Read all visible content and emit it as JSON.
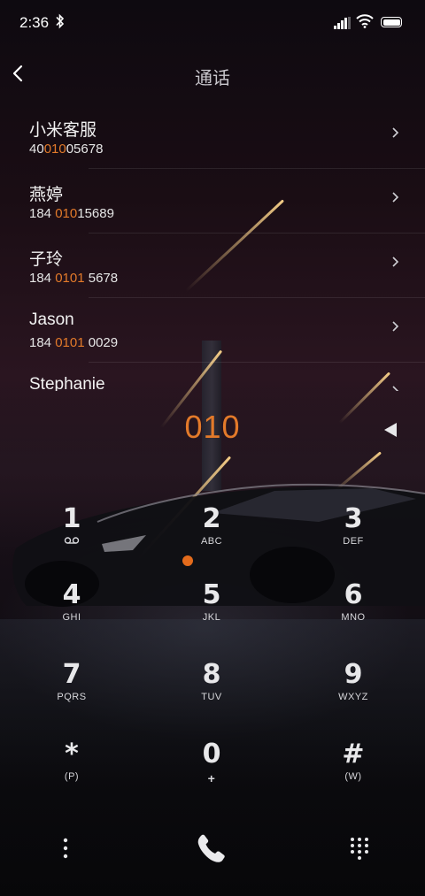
{
  "status_bar": {
    "time": "2:36",
    "bluetooth_icon": "bluetooth-icon",
    "signal_icon": "signal-icon",
    "wifi_icon": "wifi-icon",
    "battery_icon": "battery-icon"
  },
  "header": {
    "title": "通话",
    "back_icon": "back-arrow-icon"
  },
  "contacts": [
    {
      "name": "小米客服",
      "number_prefix": "40",
      "number_match": "010",
      "number_suffix": "05678"
    },
    {
      "name": "燕婷",
      "number_prefix": "184 ",
      "number_match": "010",
      "number_suffix": "15689"
    },
    {
      "name": "子玲",
      "number_prefix": "184 ",
      "number_match": "0101",
      "number_suffix": " 5678"
    },
    {
      "name": "Jason",
      "number_prefix": "184 ",
      "number_match": "0101",
      "number_suffix": " 0029"
    },
    {
      "name": "Stephanie",
      "number_prefix": "",
      "number_match": "",
      "number_suffix": ""
    }
  ],
  "dialer": {
    "input": "010",
    "delete_icon": "backspace-icon",
    "accent": "#e37a2a"
  },
  "keypad": [
    {
      "digit": "1",
      "letters": ""
    },
    {
      "digit": "2",
      "letters": "ABC"
    },
    {
      "digit": "3",
      "letters": "DEF"
    },
    {
      "digit": "4",
      "letters": "GHI"
    },
    {
      "digit": "5",
      "letters": "JKL"
    },
    {
      "digit": "6",
      "letters": "MNO"
    },
    {
      "digit": "7",
      "letters": "PQRS"
    },
    {
      "digit": "8",
      "letters": "TUV"
    },
    {
      "digit": "9",
      "letters": "WXYZ"
    },
    {
      "digit": "*",
      "letters": "(P)"
    },
    {
      "digit": "0",
      "letters": "+"
    },
    {
      "digit": "#",
      "letters": "(W)"
    }
  ],
  "bottom_bar": {
    "more_icon": "more-vertical-icon",
    "call_icon": "phone-call-icon",
    "keypad_icon": "dialpad-icon"
  }
}
